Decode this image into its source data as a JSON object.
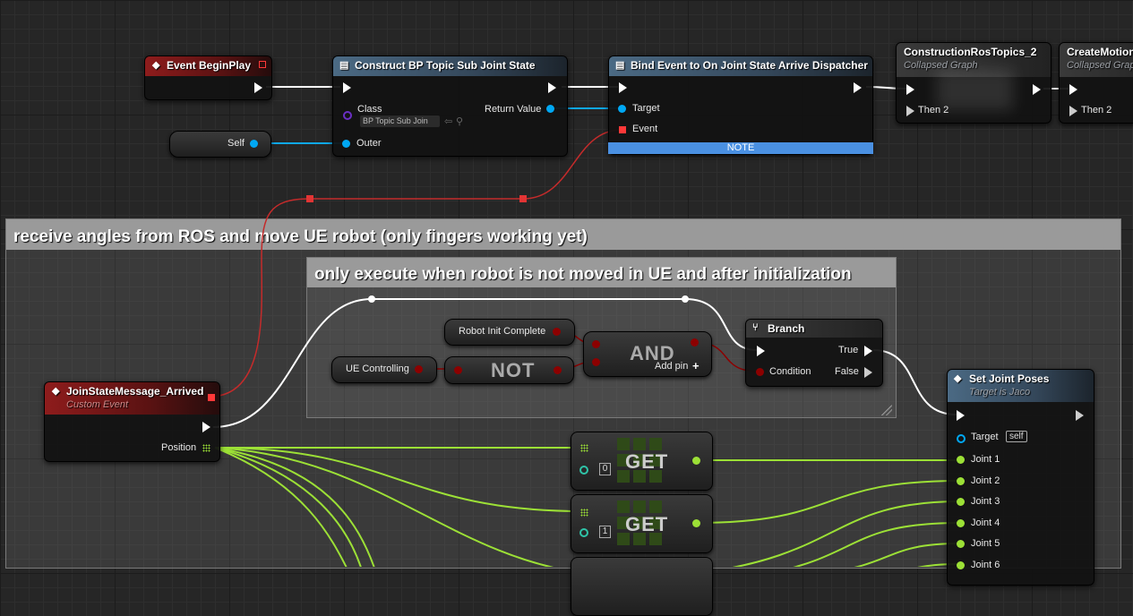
{
  "nodes": {
    "event_beginplay": {
      "title": "Event BeginPlay"
    },
    "construct": {
      "title": "Construct BP Topic Sub Joint State",
      "class_label": "Class",
      "class_value": "BP Topic Sub Join",
      "return_label": "Return Value",
      "outer_label": "Outer"
    },
    "self_node": {
      "label": "Self"
    },
    "bind_event": {
      "title": "Bind Event to On Joint State Arrive Dispatcher",
      "target_label": "Target",
      "event_label": "Event",
      "note": "NOTE"
    },
    "construction_ros": {
      "title": "ConstructionRosTopics_2",
      "subtitle": "Collapsed Graph",
      "then_label": "Then 2"
    },
    "create_motion": {
      "title": "CreateMotionC",
      "subtitle": "Collapsed Grap",
      "then_label": "Then 2"
    },
    "join_state": {
      "title": "JoinStateMessage_Arrived",
      "subtitle": "Custom Event",
      "position_label": "Position"
    },
    "robot_init": {
      "label": "Robot Init Complete"
    },
    "ue_controlling": {
      "label": "UE Controlling"
    },
    "not_node": {
      "label": "NOT"
    },
    "and_node": {
      "label": "AND",
      "add_pin": "Add pin"
    },
    "branch": {
      "title": "Branch",
      "true_label": "True",
      "false_label": "False",
      "condition_label": "Condition"
    },
    "get0": {
      "label": "GET",
      "index": "0"
    },
    "get1": {
      "label": "GET",
      "index": "1"
    },
    "set_joint": {
      "title": "Set Joint Poses",
      "subtitle": "Target is Jaco",
      "target_label": "Target",
      "self_label": "self",
      "joints": [
        "Joint 1",
        "Joint 2",
        "Joint 3",
        "Joint 4",
        "Joint 5",
        "Joint 6"
      ]
    }
  },
  "comments": {
    "outer": "receive angles from ROS and move UE robot (only fingers working yet)",
    "inner": "only execute when robot is not moved in UE and after initialization"
  },
  "colors": {
    "exec": "#ffffff",
    "object": "#00a8f4",
    "bool": "#8c0000",
    "float_array": "#9ce036",
    "delegate": "#ff3838"
  }
}
